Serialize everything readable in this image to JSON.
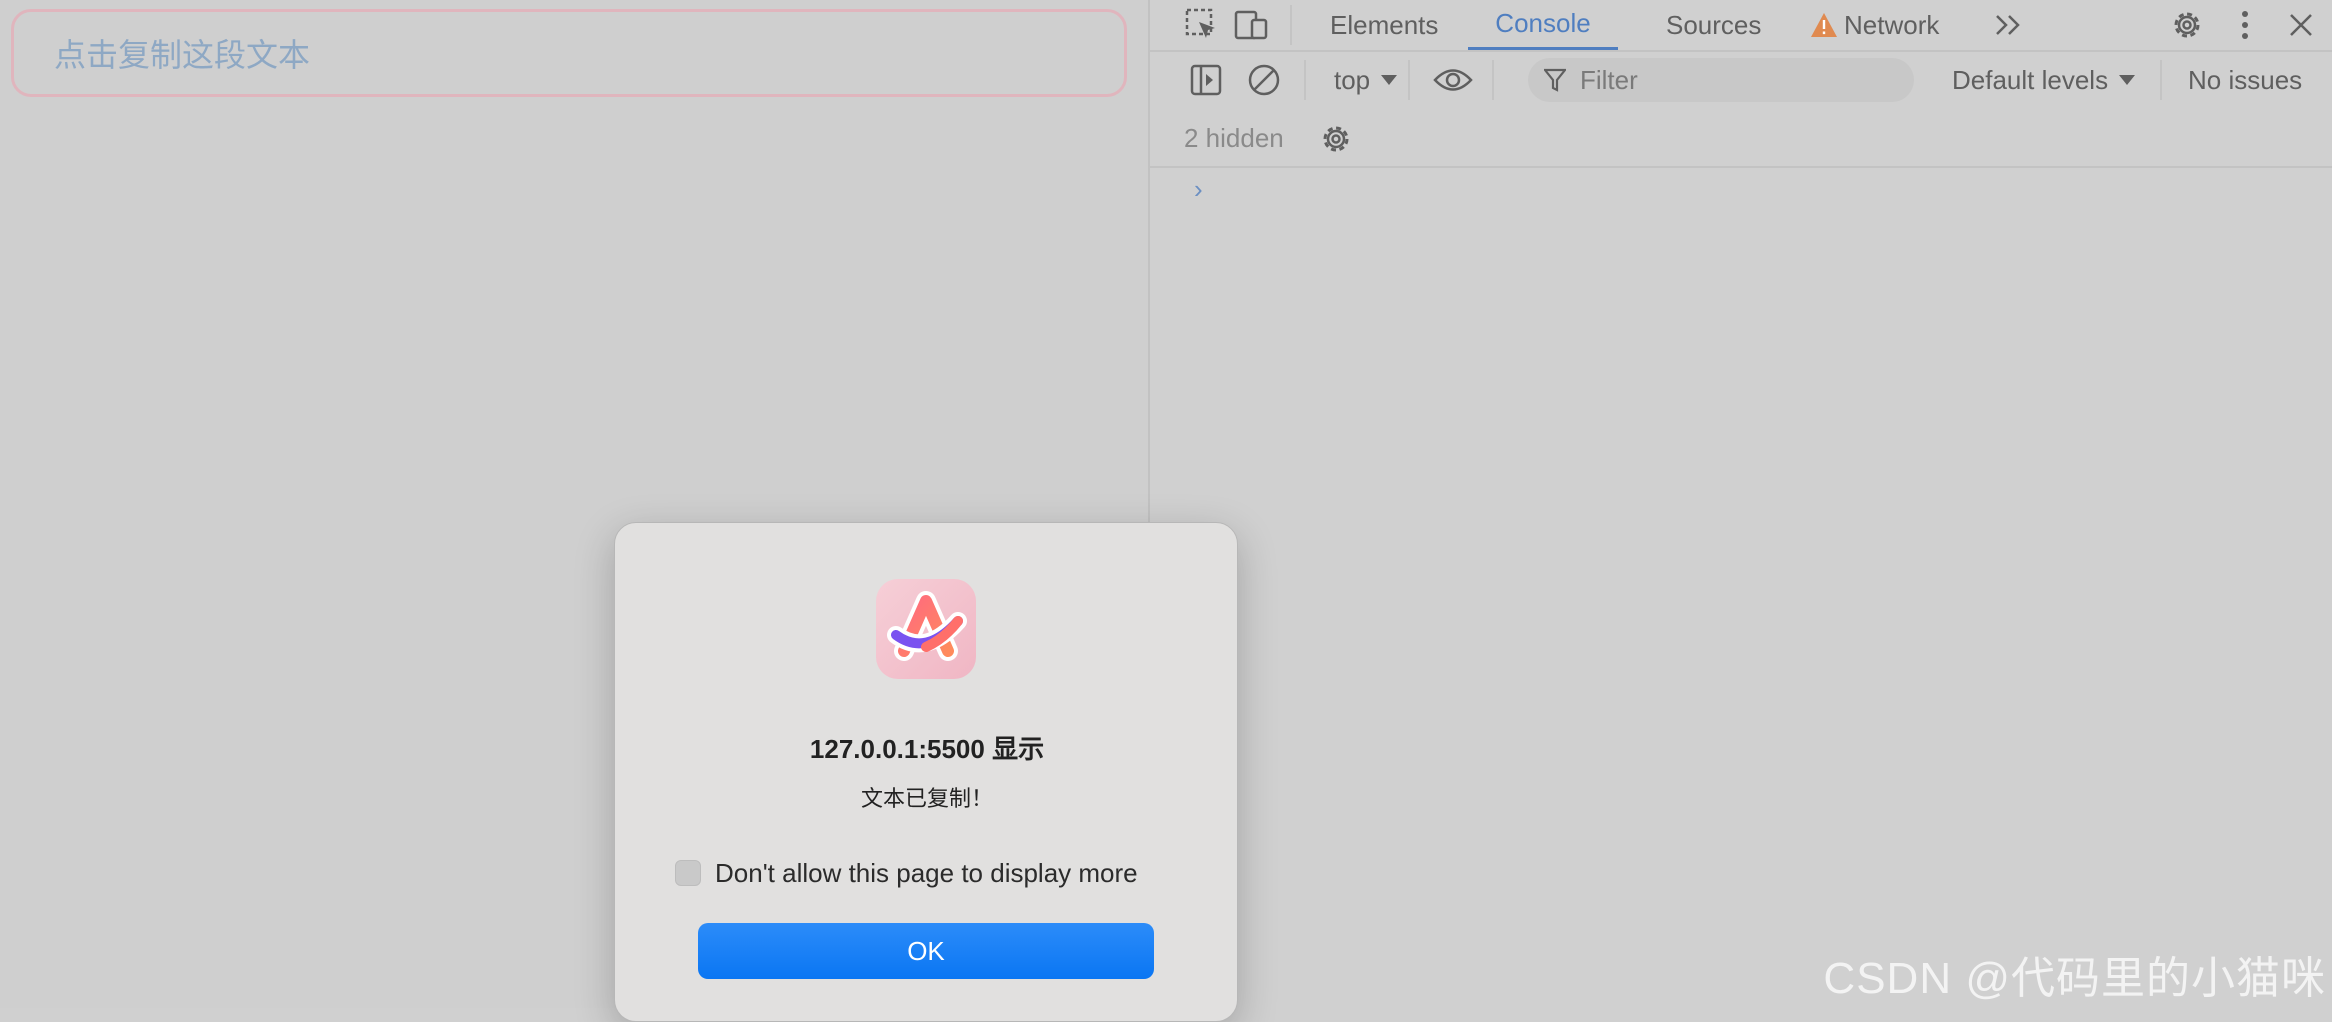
{
  "page": {
    "copy_text": "点击复制这段文本"
  },
  "devtools": {
    "tabs": [
      "Elements",
      "Console",
      "Sources",
      "Network"
    ],
    "active_tab": "Console",
    "context": "top",
    "filter_placeholder": "Filter",
    "levels": "Default levels",
    "issues": "No issues",
    "hidden": "2 hidden",
    "prompt": "›",
    "accent_color": "#4f7ec0",
    "warning_color": "#e08a50"
  },
  "dialog": {
    "title": "127.0.0.1:5500 显示",
    "message": "文本已复制！",
    "checkbox_label": "Don't allow this page to display more",
    "checkbox_checked": false,
    "ok_label": "OK",
    "button_color": "#1580f6"
  },
  "watermark": "CSDN @代码里的小猫咪"
}
